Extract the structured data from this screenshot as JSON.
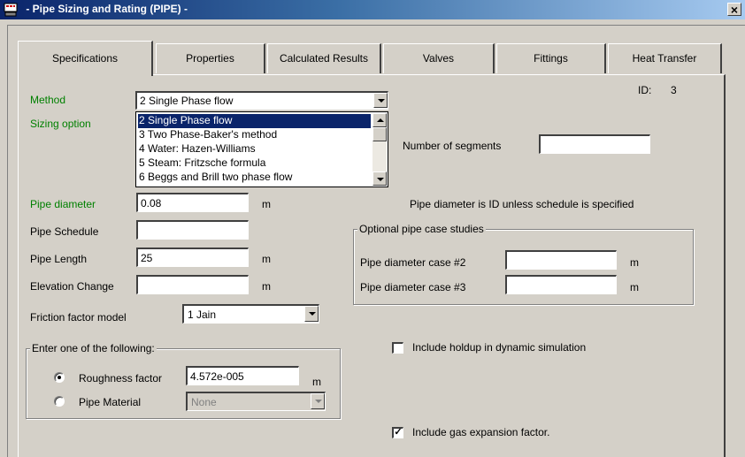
{
  "window": {
    "title": " - Pipe Sizing and Rating (PIPE) -",
    "close_label": "×"
  },
  "tabs": [
    {
      "label": "Specifications",
      "active": true
    },
    {
      "label": "Properties"
    },
    {
      "label": "Calculated Results"
    },
    {
      "label": "Valves"
    },
    {
      "label": "Fittings"
    },
    {
      "label": "Heat Transfer"
    }
  ],
  "id": {
    "label": "ID:",
    "value": "3"
  },
  "method": {
    "label": "Method",
    "value": "2 Single Phase flow"
  },
  "sizing_option": {
    "label": "Sizing option"
  },
  "method_dropdown": {
    "options": [
      "2 Single Phase flow",
      "3 Two Phase-Baker's method",
      "4 Water: Hazen-Williams",
      "5 Steam: Fritzsche formula",
      "6 Beggs and Brill two phase flow"
    ],
    "selected_index": 0
  },
  "segments": {
    "label": "Number of segments",
    "value": ""
  },
  "pipe_diameter": {
    "label": "Pipe diameter",
    "value": "0.08",
    "unit": "m"
  },
  "diameter_note": "Pipe diameter is ID unless schedule is specified",
  "pipe_schedule": {
    "label": "Pipe Schedule",
    "value": ""
  },
  "pipe_length": {
    "label": "Pipe Length",
    "value": "25",
    "unit": "m"
  },
  "elevation_change": {
    "label": "Elevation Change",
    "value": "",
    "unit": "m"
  },
  "case_studies": {
    "title": "Optional pipe case studies",
    "case2": {
      "label": "Pipe diameter case #2",
      "value": "",
      "unit": "m"
    },
    "case3": {
      "label": "Pipe diameter case #3",
      "value": "",
      "unit": "m"
    }
  },
  "friction": {
    "label": "Friction factor model",
    "value": "1 Jain"
  },
  "enter_one": {
    "title": "Enter one of the following:",
    "roughness": {
      "label": "Roughness factor",
      "value": "4.572e-005",
      "unit": "m",
      "selected": true
    },
    "material": {
      "label": "Pipe Material",
      "value": "None",
      "selected": false
    }
  },
  "holdup": {
    "label": "Include holdup in dynamic simulation",
    "checked": false
  },
  "gas_expansion": {
    "label": "Include gas expansion factor.",
    "checked": true,
    "check_glyph": "✓"
  }
}
